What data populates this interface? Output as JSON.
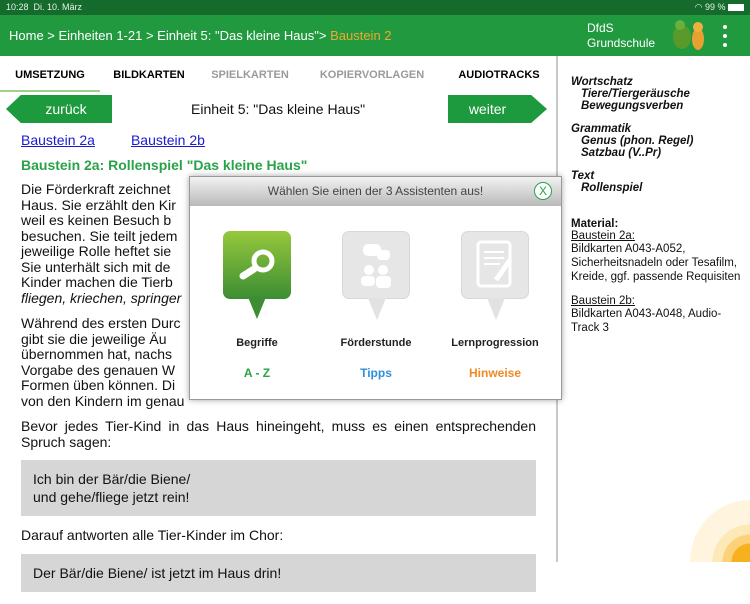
{
  "status": {
    "time": "10:28",
    "date": "Di. 10. März",
    "battery": "99 %"
  },
  "header": {
    "crumb": "Home > Einheiten 1-21 > Einheit 5: \"Das kleine Haus\">",
    "crumb_current": "Baustein 2",
    "brand_line1": "DfdS",
    "brand_line2": "Grundschule"
  },
  "tabs": [
    "UMSETZUNG",
    "BILDKARTEN",
    "SPIELKARTEN",
    "KOPIERVORLAGEN",
    "AUDIOTRACKS"
  ],
  "nav": {
    "back": "zurück",
    "next": "weiter",
    "title": "Einheit 5: \"Das kleine Haus\""
  },
  "links": [
    "Baustein 2a",
    "Baustein 2b"
  ],
  "subtitle": "Baustein 2a: Rollenspiel \"Das kleine Haus\"",
  "paragraphs": [
    "Die Förderkraft zeichnet ",
    "Haus. Sie erzählt den Kir",
    "weil es keinen Besuch b",
    "besuchen. Sie teilt jedem",
    "jeweilige Rolle heftet sie",
    "Sie unterhält sich mit de",
    "Kinder machen die Tierb",
    "fliegen, kriechen, springer",
    "Während des ersten Durc",
    "gibt sie die jeweilige Äu",
    "übernommen hat, nachs",
    "Vorgabe des genauen W",
    "Formen üben können. Di",
    "von den Kindern im genau"
  ],
  "para3": "Bevor jedes Tier-Kind in das Haus hineingeht, muss es einen entsprechenden Spruch sagen:",
  "quote1_line1": "Ich bin der Bär/die Biene/",
  "quote1_line2": "und gehe/fliege jetzt rein!",
  "para4": "Darauf antworten alle Tier-Kinder im Chor:",
  "quote2": "Der Bär/die Biene/ ist jetzt im Haus drin!",
  "side": {
    "wortschatz": "Wortschatz",
    "w1": "Tiere/Tiergeräusche",
    "w2": "Bewegungsverben",
    "grammatik": "Grammatik",
    "g1": "Genus (phon. Regel)",
    "g2": "Satzbau (V..Pr)",
    "text": "Text",
    "t1": "Rollenspiel",
    "material": "Material:",
    "b2a": "Baustein 2a:",
    "b2a_text": "Bildkarten A043-A052, Sicherheitsnadeln oder Tesafilm, Kreide, ggf. passende Requisiten",
    "b2b": "Baustein 2b:",
    "b2b_text": "Bildkarten A043-A048, Audio-Track 3"
  },
  "modal": {
    "title": "Wählen Sie einen der 3 Assistenten aus!",
    "close": "X",
    "options": [
      {
        "label": "Begriffe",
        "sub": "A - Z",
        "color": "#2aa24a",
        "icon": "search-icon"
      },
      {
        "label": "Förderstunde",
        "sub": "Tipps",
        "color": "#2f8fd8",
        "icon": "chat-people-icon"
      },
      {
        "label": "Lernprogression",
        "sub": "Hinweise",
        "color": "#f08a24",
        "icon": "document-edit-icon"
      }
    ]
  }
}
